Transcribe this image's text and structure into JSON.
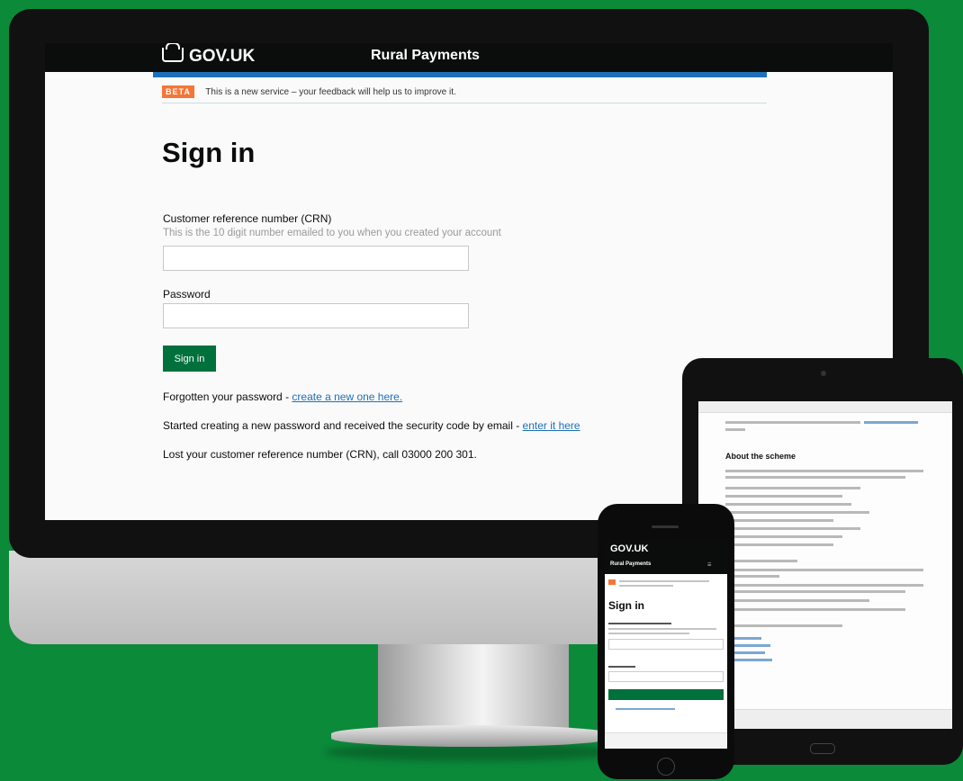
{
  "header": {
    "logo_text": "GOV.UK",
    "service_name": "Rural Payments"
  },
  "beta_banner": {
    "tag": "BETA",
    "text": "This is a new service – your feedback will help us to improve it."
  },
  "form": {
    "title": "Sign in",
    "crn_label": "Customer reference number (CRN)",
    "crn_hint": "This is the 10 digit number emailed to you when you created your account",
    "crn_value": "",
    "password_label": "Password",
    "password_value": "",
    "submit_label": "Sign in"
  },
  "help_links": {
    "forgotten_prefix": "Forgotten your password - ",
    "forgotten_link": "create a new one here.",
    "started_prefix": "Started creating a new password and received the security code by email - ",
    "started_link": "enter it here",
    "lost_crn": "Lost your customer reference number (CRN), call 03000 200 301."
  },
  "tablet": {
    "section_title": "About the scheme"
  },
  "phone": {
    "logo_text": "GOV.UK",
    "service_name": "Rural Payments",
    "title": "Sign in"
  },
  "colors": {
    "background": "#0b8a3a",
    "govuk_black": "#0b0c0c",
    "brand_blue": "#1d70b8",
    "beta_orange": "#f47738",
    "button_green": "#00703c"
  }
}
